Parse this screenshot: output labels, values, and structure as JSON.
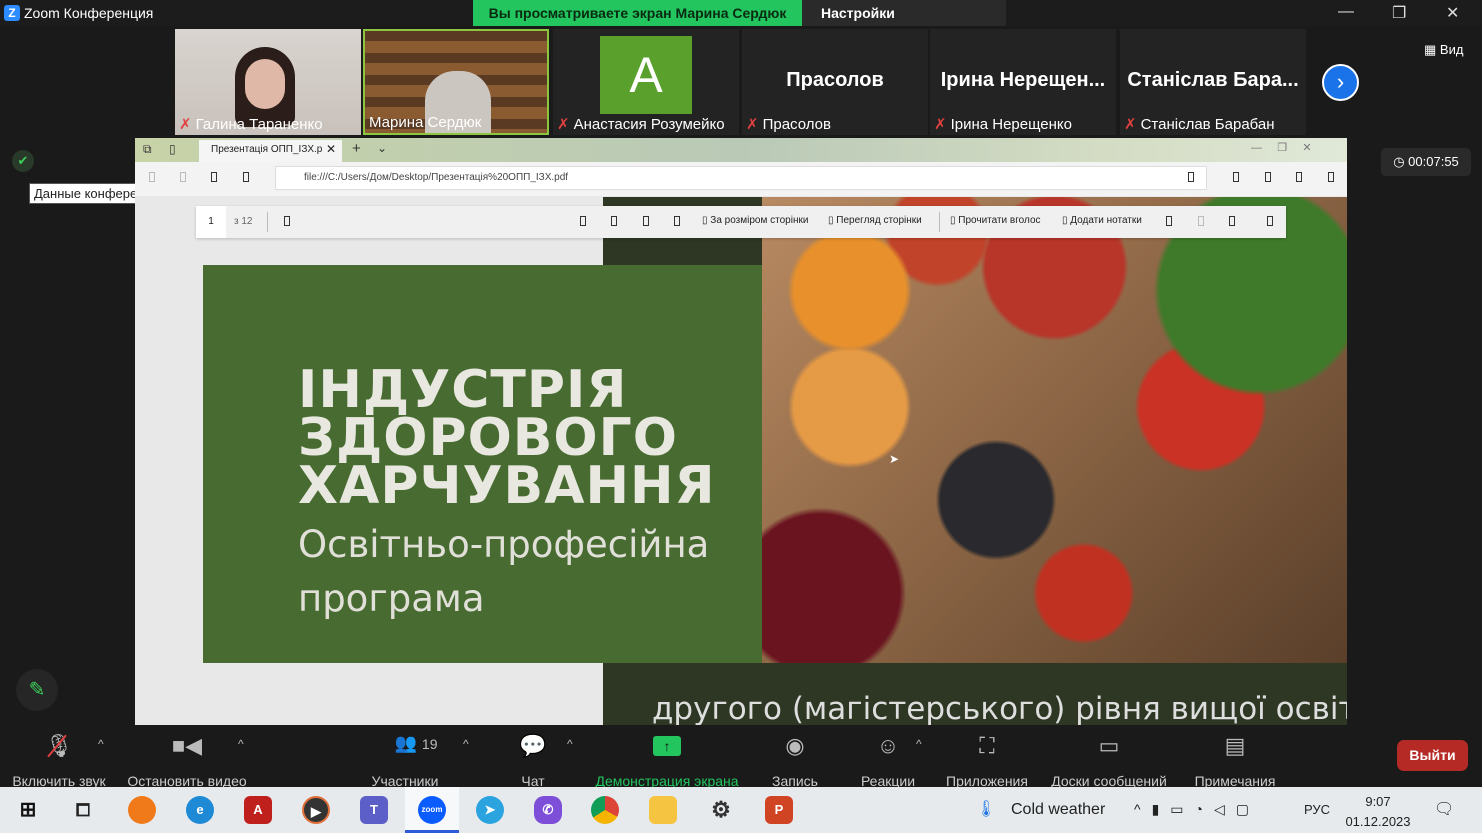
{
  "window": {
    "title": "Zoom Конференция",
    "banner": "Вы просматриваете экран Марина Сердюк",
    "view_settings": "Настройки просмотра",
    "view_button": "Вид",
    "timer": "00:07:55",
    "tooltip": "Данные конференции"
  },
  "participants": [
    {
      "name": "Галина Тараненко",
      "muted": true
    },
    {
      "name": "Марина Сердюк",
      "muted": false
    },
    {
      "name": "Анастасия Розумейко",
      "muted": true,
      "avatar": "A"
    },
    {
      "name": "Прасолов",
      "muted": true,
      "display": "Прасолов"
    },
    {
      "name": "Ірина Нерещенко",
      "muted": true,
      "display": "Ірина  Нерещен..."
    },
    {
      "name": "Станіслав Барабан",
      "muted": true,
      "display": "Станіслав  Бара..."
    }
  ],
  "browser": {
    "tab_title": "Презентація ОПП_ІЗХ.p",
    "url": "file:///C:/Users/Дом/Desktop/Презентація%20ОПП_ІЗХ.pdf",
    "page": "1",
    "page_total": "з 12",
    "fit": "За розміром сторінки",
    "page_view": "Перегляд сторінки",
    "read_aloud": "Прочитати вголос",
    "add_notes": "Додати нотатки"
  },
  "slide": {
    "title": "ІНДУСТРІЯ ЗДОРОВОГО ХАРЧУВАННЯ",
    "subtitle1": "Освітньо-професійна",
    "subtitle2": "програма",
    "footer": "другого (магістерського) рівня вищої освіти"
  },
  "toolbar": {
    "unmute": "Включить звук",
    "stop_video": "Остановить видео",
    "participants": "Участники",
    "participants_count": "19",
    "chat": "Чат",
    "share": "Демонстрация экрана",
    "record": "Запись",
    "reactions": "Реакции",
    "apps": "Приложения",
    "whiteboards": "Доски сообщений",
    "notes": "Примечания",
    "leave": "Выйти"
  },
  "taskbar": {
    "weather": "Cold weather",
    "lang": "РУС",
    "time": "9:07",
    "date": "01.12.2023"
  }
}
